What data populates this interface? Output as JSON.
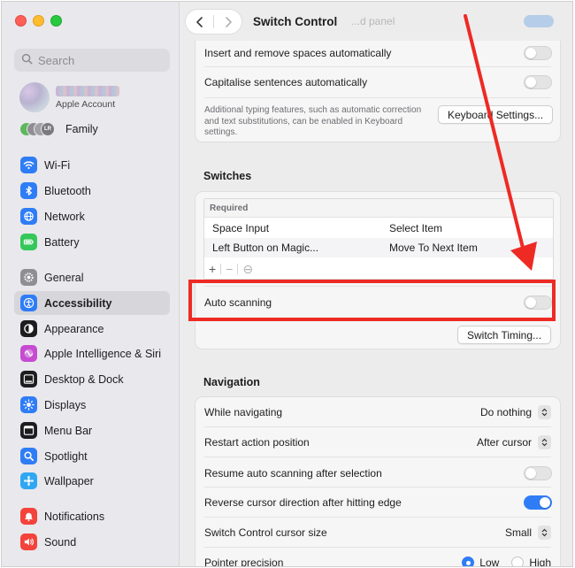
{
  "toolbar": {
    "title": "Switch Control",
    "ghost_title": "...d panel"
  },
  "sidebar": {
    "search_placeholder": "Search",
    "account": {
      "label": "Apple Account"
    },
    "family": {
      "label": "Family",
      "avatar_initials": "LR"
    },
    "items": [
      {
        "label": "Wi-Fi",
        "icon": "wifi-icon",
        "color": "#2f7df6"
      },
      {
        "label": "Bluetooth",
        "icon": "bluetooth-icon",
        "color": "#2f7df6"
      },
      {
        "label": "Network",
        "icon": "globe-icon",
        "color": "#2f7df6"
      },
      {
        "label": "Battery",
        "icon": "battery-icon",
        "color": "#34c759"
      },
      {
        "label": "General",
        "icon": "gear-icon",
        "color": "#8e8e93"
      },
      {
        "label": "Accessibility",
        "icon": "accessibility-icon",
        "color": "#2f7df6",
        "selected": true
      },
      {
        "label": "Appearance",
        "icon": "appearance-icon",
        "color": "#1d1d1f"
      },
      {
        "label": "Apple Intelligence & Siri",
        "icon": "siri-icon",
        "color": "#c54bd1"
      },
      {
        "label": "Desktop & Dock",
        "icon": "dock-icon",
        "color": "#1d1d1f"
      },
      {
        "label": "Displays",
        "icon": "sun-icon",
        "color": "#2f7df6"
      },
      {
        "label": "Menu Bar",
        "icon": "menu-bar-icon",
        "color": "#1d1d1f"
      },
      {
        "label": "Spotlight",
        "icon": "magnifier-icon",
        "color": "#2f7df6"
      },
      {
        "label": "Wallpaper",
        "icon": "wallpaper-icon",
        "color": "#2fa7f2"
      },
      {
        "label": "Notifications",
        "icon": "bell-icon",
        "color": "#f4433c"
      },
      {
        "label": "Sound",
        "icon": "speaker-icon",
        "color": "#f4433c"
      }
    ]
  },
  "typing": {
    "insert_spaces_label": "Insert and remove spaces automatically",
    "insert_spaces_on": false,
    "capitalise_label": "Capitalise sentences automatically",
    "capitalise_on": false,
    "note": "Additional typing features, such as automatic correction and text substitutions, can be enabled in Keyboard settings.",
    "keyboard_settings_button": "Keyboard Settings..."
  },
  "switches": {
    "header": "Switches",
    "table_header": "Required",
    "rows": [
      {
        "name": "Space Input",
        "action": "Select Item"
      },
      {
        "name": "Left Button on  Magic...",
        "action": "Move To Next Item"
      }
    ],
    "add": "+",
    "remove": "−",
    "more": "⊖",
    "auto_scanning_label": "Auto scanning",
    "auto_scanning_on": false,
    "switch_timing_button": "Switch Timing..."
  },
  "navigation": {
    "header": "Navigation",
    "while_navigating_label": "While navigating",
    "while_navigating_value": "Do nothing",
    "restart_label": "Restart action position",
    "restart_value": "After cursor",
    "resume_label": "Resume auto scanning after selection",
    "resume_on": false,
    "reverse_label": "Reverse cursor direction after hitting edge",
    "reverse_on": true,
    "cursor_size_label": "Switch Control cursor size",
    "cursor_size_value": "Small",
    "pointer_precision_label": "Pointer precision",
    "pointer_low": "Low",
    "pointer_high": "High",
    "pointer_selected": "Low"
  },
  "colors": {
    "accent": "#2f7df6",
    "annotation": "#ee2a24"
  }
}
